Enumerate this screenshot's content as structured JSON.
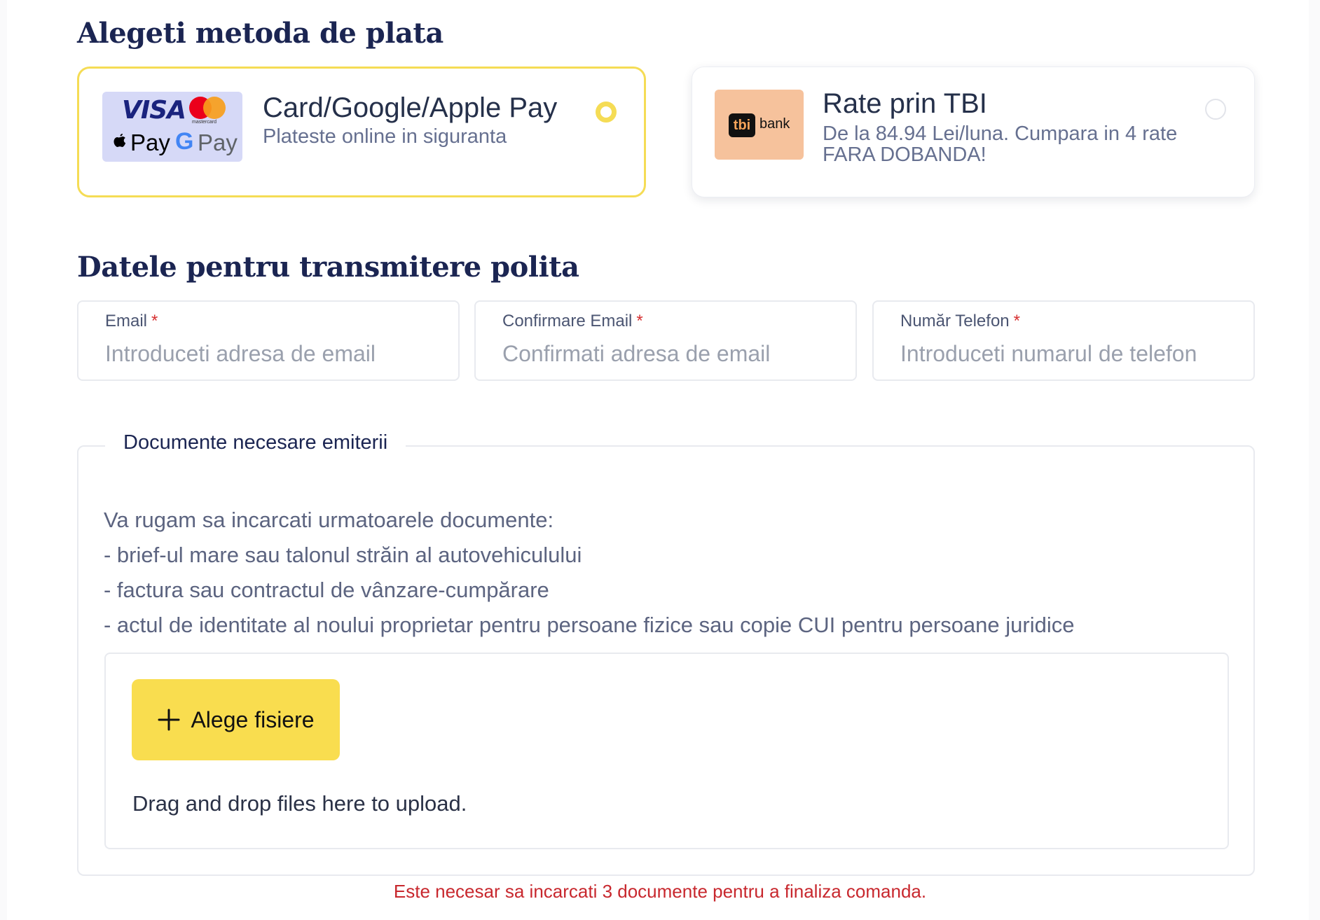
{
  "payment": {
    "title": "Alegeti metoda de plata",
    "options": [
      {
        "title": "Card/Google/Apple Pay",
        "subtitle": "Plateste online in siguranta",
        "selected": true,
        "logo": {
          "visa": "VISA",
          "mastercard": "mastercard",
          "apple_pay": "Pay",
          "google_pay": "Pay"
        }
      },
      {
        "title": "Rate prin TBI",
        "subtitle_line1": "De la 84.94 Lei/luna. Cumpara in 4 rate",
        "subtitle_line2": "FARA DOBANDA!",
        "selected": false,
        "logo": {
          "tbi": "tbi",
          "bank": "bank"
        }
      }
    ],
    "accent_color": "#f5dc55"
  },
  "contact": {
    "title": "Datele pentru transmitere polita",
    "required_mark": "*",
    "fields": [
      {
        "label": "Email",
        "placeholder": "Introduceti adresa de email",
        "value": ""
      },
      {
        "label": "Confirmare Email",
        "placeholder": "Confirmati adresa de email",
        "value": ""
      },
      {
        "label": "Număr Telefon",
        "placeholder": "Introduceti numarul de telefon",
        "value": ""
      }
    ]
  },
  "documents": {
    "legend": "Documente necesare emiterii",
    "lines": [
      "Va rugam sa incarcati urmatoarele documente:",
      "- brief-ul mare sau talonul străin al autovehiculului",
      "- factura sau contractul de vânzare-cumpărare",
      "- actul de identitate al noului proprietar pentru persoane fizice sau copie CUI pentru persoane juridice"
    ],
    "upload": {
      "button_label": "Alege fisiere",
      "drop_text": "Drag and drop files here to upload."
    },
    "error": "Este necesar sa incarcati 3 documente pentru a finaliza comanda.",
    "button_color": "#f9dd4f",
    "error_color": "#c8282e"
  }
}
